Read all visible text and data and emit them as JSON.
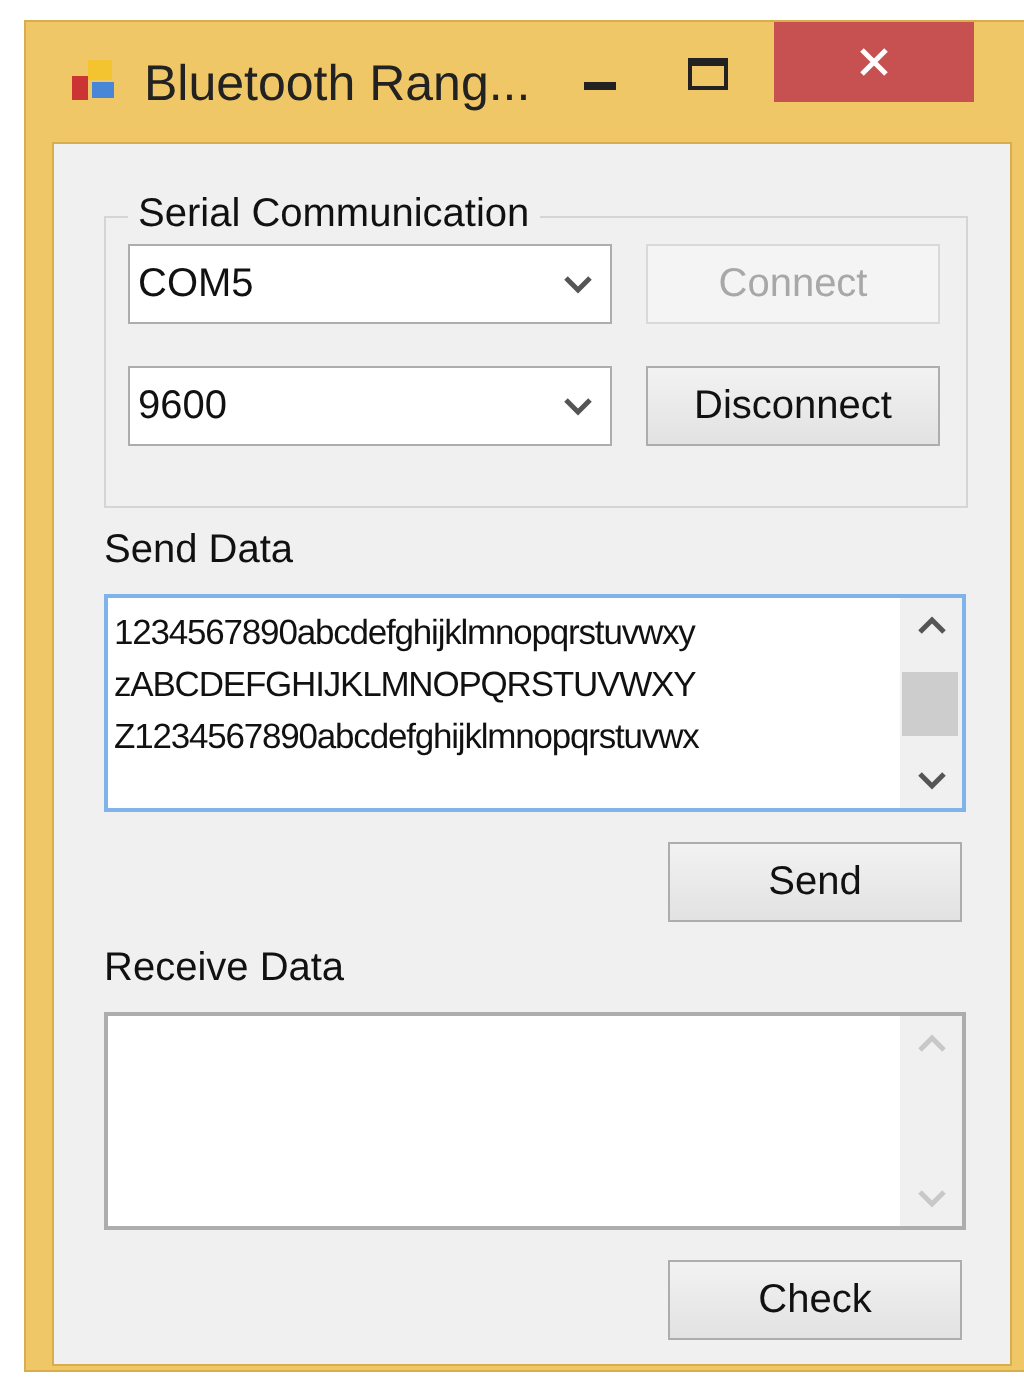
{
  "window": {
    "title": "Bluetooth Rang..."
  },
  "serial_communication": {
    "label": "Serial Communication",
    "rows": [
      {
        "combo": {
          "value": "COM5"
        },
        "button": {
          "label": "Connect",
          "disabled": true
        }
      },
      {
        "combo": {
          "value": "9600"
        },
        "button": {
          "label": "Disconnect",
          "disabled": false
        }
      }
    ]
  },
  "send_data": {
    "label": "Send Data",
    "focused": true,
    "lines": [
      "1234567890abcdefghijklmnopqrstuvwxy",
      "zABCDEFGHIJKLMNOPQRSTUVWXY",
      "Z1234567890abcdefghijklmnopqrstuvwx"
    ],
    "button": "Send"
  },
  "receive_data": {
    "label": "Receive Data",
    "focused": false,
    "button": "Check"
  }
}
